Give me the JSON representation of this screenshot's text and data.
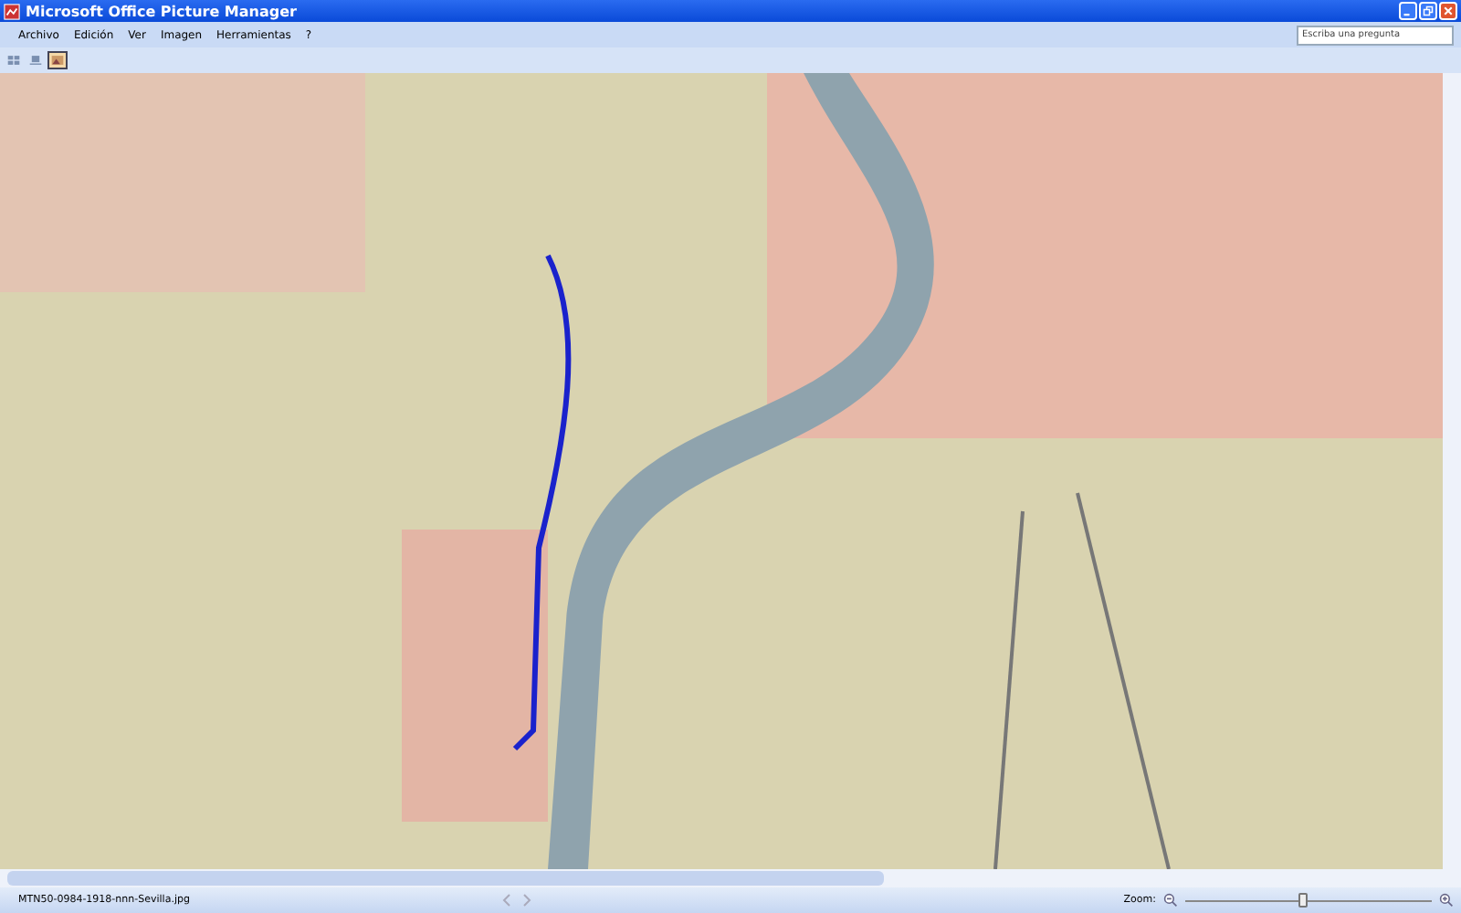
{
  "window": {
    "title": "Microsoft Office Picture Manager"
  },
  "menu": [
    {
      "label": "Archivo"
    },
    {
      "label": "Edición"
    },
    {
      "label": "Ver"
    },
    {
      "label": "Imagen"
    },
    {
      "label": "Herramientas"
    },
    {
      "label": "?"
    }
  ],
  "help_box": {
    "placeholder": "Escriba una pregunta"
  },
  "view_buttons": [
    {
      "kind": "thumbnails",
      "selected": false
    },
    {
      "kind": "filmstrip",
      "selected": false
    },
    {
      "kind": "single",
      "selected": true
    }
  ],
  "status_bar": {
    "filename": "MTN50-0984-1918-nnn-Sevilla.jpg",
    "zoom_label": "Zoom:",
    "zoom": {
      "level": 0.48
    }
  }
}
